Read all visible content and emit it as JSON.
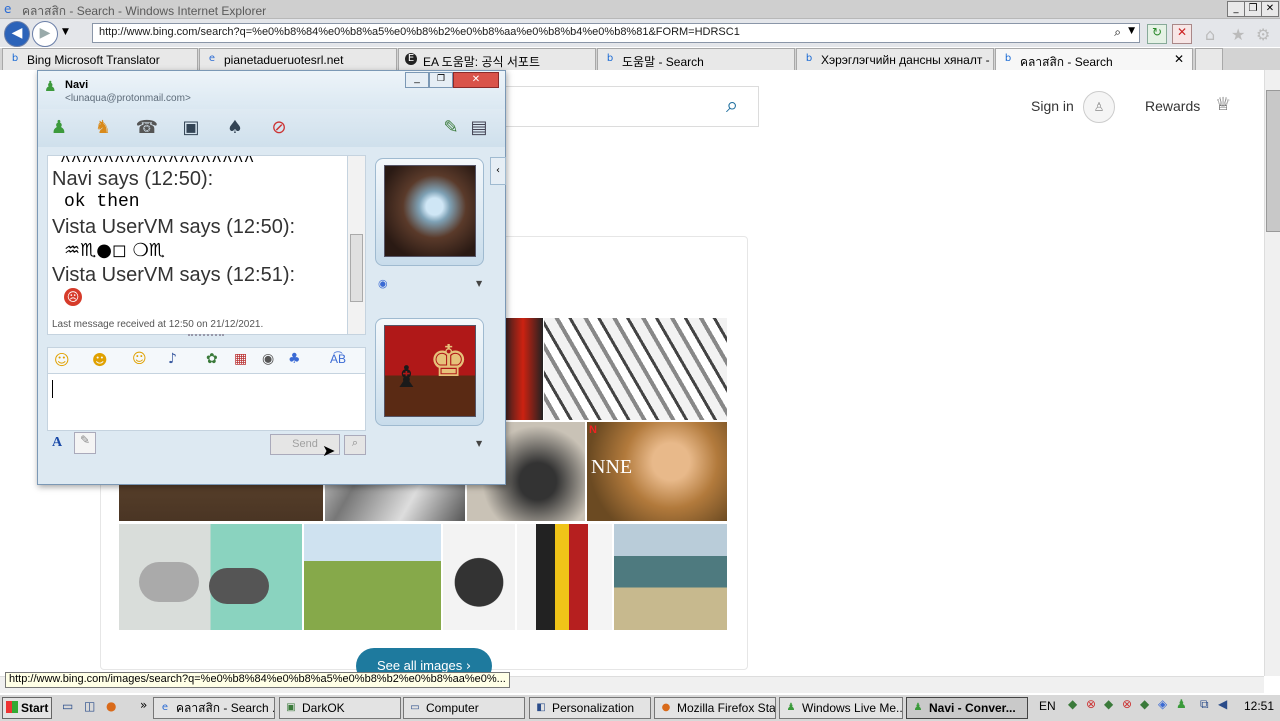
{
  "ie": {
    "title": "คลาสสิก - Search - Windows Internet Explorer",
    "url": "http://www.bing.com/search?q=%e0%b8%84%e0%b8%a5%e0%b8%b2%e0%b8%aa%e0%b8%b4%e0%b8%81&FORM=HDRSC1",
    "status_url": "http://www.bing.com/images/search?q=%e0%b8%84%e0%b8%a5%e0%b8%b2%e0%b8%aa%e0%..."
  },
  "tabs": [
    {
      "label": "Bing Microsoft Translator"
    },
    {
      "label": "pianetadueruotesrl.net"
    },
    {
      "label": "EA 도움말: 공식 서포트"
    },
    {
      "label": "도움말 - Search"
    },
    {
      "label": "Хэрэглэгчийн дансны хяналт - ..."
    },
    {
      "label": "คลาสสิก - Search"
    }
  ],
  "bing": {
    "signin": "Sign in",
    "rewards": "Rewards",
    "see_all": "See all images"
  },
  "messenger": {
    "contact_name": "Navi",
    "contact_email": "<lunaqua@protonmail.com>",
    "lines": [
      {
        "kind": "msg",
        "text": "^^^^^^^^^^^^^^^^^^"
      },
      {
        "kind": "say",
        "text": "Navi says (12:50):"
      },
      {
        "kind": "msg",
        "text": "ok then"
      },
      {
        "kind": "say",
        "text": "Vista UserVM says (12:50):"
      },
      {
        "kind": "msg",
        "text": "♒♏●◻ ❍♏"
      },
      {
        "kind": "say",
        "text": "Vista UserVM says (12:51):"
      }
    ],
    "last_message": "Last message received at 12:50 on 21/12/2021.",
    "send_label": "Send"
  },
  "taskbar": {
    "start": "Start",
    "buttons": [
      {
        "label": "คลาสสิก - Search ..."
      },
      {
        "label": "DarkOK"
      },
      {
        "label": "Computer"
      },
      {
        "label": "Personalization"
      },
      {
        "label": "Mozilla Firefox Sta..."
      },
      {
        "label": "Windows Live Me..."
      },
      {
        "label": "Navi - Conver..."
      }
    ],
    "lang": "EN",
    "clock": "12:51"
  }
}
